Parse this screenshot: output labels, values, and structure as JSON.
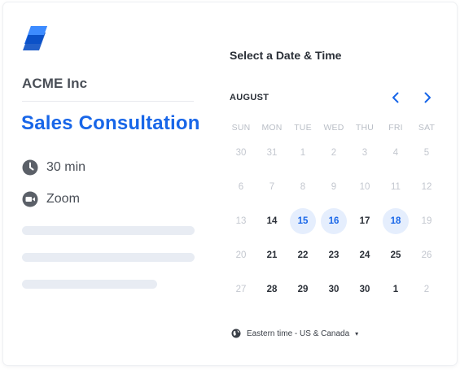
{
  "brand": {
    "logo_icon": "stacked-layers-logo",
    "accent_color": "#1866e8"
  },
  "event": {
    "company": "ACME Inc",
    "title": "Sales Consultation",
    "duration_icon": "clock-icon",
    "duration": "30 min",
    "location_icon": "video-camera-icon",
    "location": "Zoom"
  },
  "calendar": {
    "heading": "Select a Date & Time",
    "month": "AUGUST",
    "prev_icon": "chevron-left-icon",
    "next_icon": "chevron-right-icon",
    "weekdays": [
      "SUN",
      "MON",
      "TUE",
      "WED",
      "THU",
      "FRI",
      "SAT"
    ],
    "weeks": [
      [
        {
          "day": "30",
          "state": "disabled"
        },
        {
          "day": "31",
          "state": "disabled"
        },
        {
          "day": "1",
          "state": "disabled"
        },
        {
          "day": "2",
          "state": "disabled"
        },
        {
          "day": "3",
          "state": "disabled"
        },
        {
          "day": "4",
          "state": "disabled"
        },
        {
          "day": "5",
          "state": "disabled"
        }
      ],
      [
        {
          "day": "6",
          "state": "disabled"
        },
        {
          "day": "7",
          "state": "disabled"
        },
        {
          "day": "8",
          "state": "disabled"
        },
        {
          "day": "9",
          "state": "disabled"
        },
        {
          "day": "10",
          "state": "disabled"
        },
        {
          "day": "11",
          "state": "disabled"
        },
        {
          "day": "12",
          "state": "disabled"
        }
      ],
      [
        {
          "day": "13",
          "state": "disabled"
        },
        {
          "day": "14",
          "state": "enabled"
        },
        {
          "day": "15",
          "state": "available"
        },
        {
          "day": "16",
          "state": "available"
        },
        {
          "day": "17",
          "state": "enabled"
        },
        {
          "day": "18",
          "state": "available"
        },
        {
          "day": "19",
          "state": "disabled"
        }
      ],
      [
        {
          "day": "20",
          "state": "disabled"
        },
        {
          "day": "21",
          "state": "enabled"
        },
        {
          "day": "22",
          "state": "enabled"
        },
        {
          "day": "23",
          "state": "enabled"
        },
        {
          "day": "24",
          "state": "enabled"
        },
        {
          "day": "25",
          "state": "enabled"
        },
        {
          "day": "26",
          "state": "disabled"
        }
      ],
      [
        {
          "day": "27",
          "state": "disabled"
        },
        {
          "day": "28",
          "state": "enabled"
        },
        {
          "day": "29",
          "state": "enabled"
        },
        {
          "day": "30",
          "state": "enabled"
        },
        {
          "day": "30",
          "state": "enabled"
        },
        {
          "day": "1",
          "state": "enabled"
        },
        {
          "day": "2",
          "state": "disabled"
        }
      ]
    ],
    "timezone_icon": "globe-icon",
    "timezone": "Eastern time - US & Canada",
    "timezone_caret": "▾"
  }
}
